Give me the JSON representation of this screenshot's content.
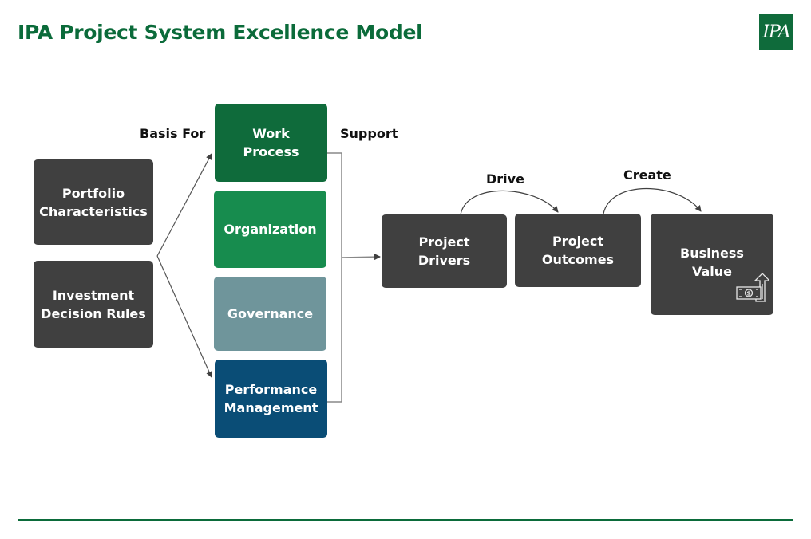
{
  "header": {
    "title": "IPA Project System Excellence Model",
    "logo_text": "IPA",
    "brand_color": "#0b6b3a"
  },
  "diagram": {
    "inputs": [
      {
        "id": "portfolio",
        "lines": [
          "Portfolio",
          "Characteristics"
        ],
        "color": "#404040"
      },
      {
        "id": "investment",
        "lines": [
          "Investment",
          "Decision Rules"
        ],
        "color": "#404040"
      }
    ],
    "system_elements": [
      {
        "id": "work-process",
        "lines": [
          "Work",
          "Process"
        ],
        "color": "#0f6b3b"
      },
      {
        "id": "organization",
        "lines": [
          "Organization"
        ],
        "color": "#178c4e"
      },
      {
        "id": "governance",
        "lines": [
          "Governance"
        ],
        "color": "#6f959b"
      },
      {
        "id": "performance-management",
        "lines": [
          "Performance",
          "Management"
        ],
        "color": "#0a4d76"
      }
    ],
    "flow": [
      {
        "id": "project-drivers",
        "lines": [
          "Project",
          "Drivers"
        ],
        "color": "#404040"
      },
      {
        "id": "project-outcomes",
        "lines": [
          "Project",
          "Outcomes"
        ],
        "color": "#404040"
      },
      {
        "id": "business-value",
        "lines": [
          "Business",
          "Value"
        ],
        "color": "#404040",
        "icon": "money-growth-icon"
      }
    ],
    "edge_labels": {
      "basis_for": "Basis For",
      "support": "Support",
      "drive": "Drive",
      "create": "Create"
    }
  }
}
